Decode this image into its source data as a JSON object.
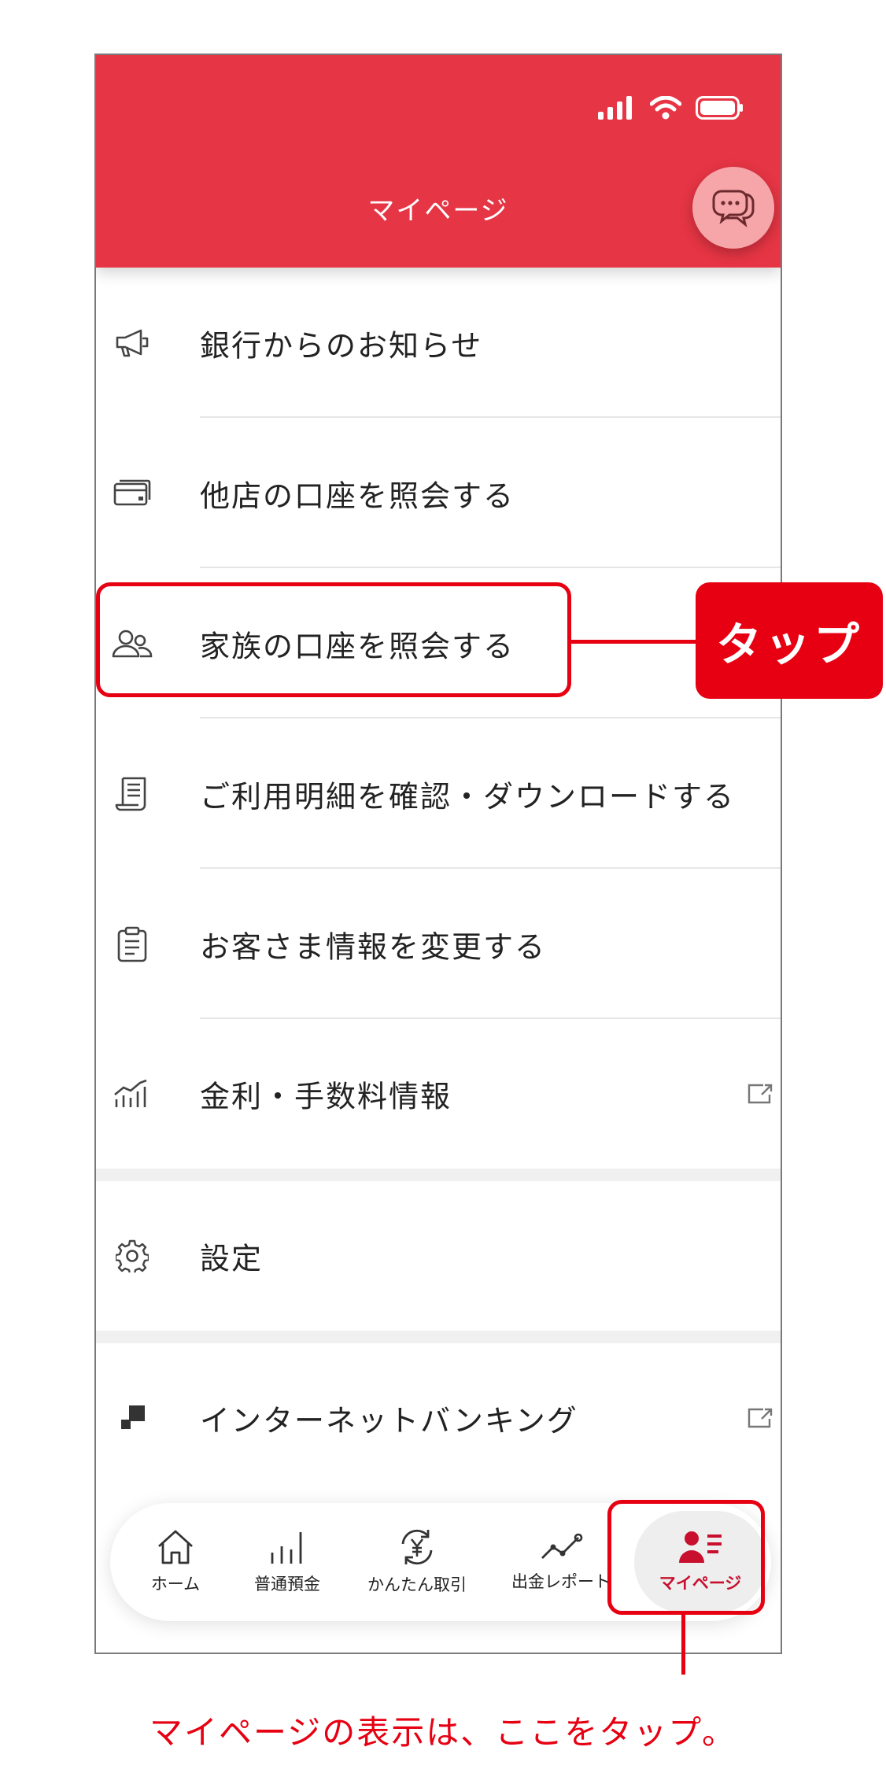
{
  "header": {
    "title": "マイページ",
    "accent_color": "#e63544",
    "chat_icon": "chat-bubbles-icon"
  },
  "menu": {
    "items": [
      {
        "label": "銀行からのお知らせ",
        "icon": "megaphone-icon"
      },
      {
        "label": "他店の口座を照会する",
        "icon": "card-stack-icon"
      },
      {
        "label": "家族の口座を照会する",
        "icon": "family-icon"
      },
      {
        "label": "ご利用明細を確認・ダウンロードする",
        "icon": "statement-icon"
      },
      {
        "label": "お客さま情報を変更する",
        "icon": "clipboard-icon"
      },
      {
        "label": "金利・手数料情報",
        "icon": "rate-chart-icon",
        "external": true
      },
      {
        "label": "設定",
        "icon": "gear-icon"
      },
      {
        "label": "インターネットバンキング",
        "icon": "blocks-icon",
        "external": true
      }
    ]
  },
  "tabbar": {
    "tabs": [
      {
        "label": "ホーム",
        "icon": "home-icon"
      },
      {
        "label": "普通預金",
        "icon": "bars-icon"
      },
      {
        "label": "かんたん取引",
        "icon": "yen-exchange-icon"
      },
      {
        "label": "出金レポート",
        "icon": "trend-line-icon"
      },
      {
        "label": "マイページ",
        "icon": "user-list-icon",
        "active": true
      }
    ],
    "active_color": "#c8102e"
  },
  "annotations": {
    "callout_label": "タップ",
    "caption": "マイページの表示は、ここをタップ。",
    "highlight_color": "#e60012"
  }
}
